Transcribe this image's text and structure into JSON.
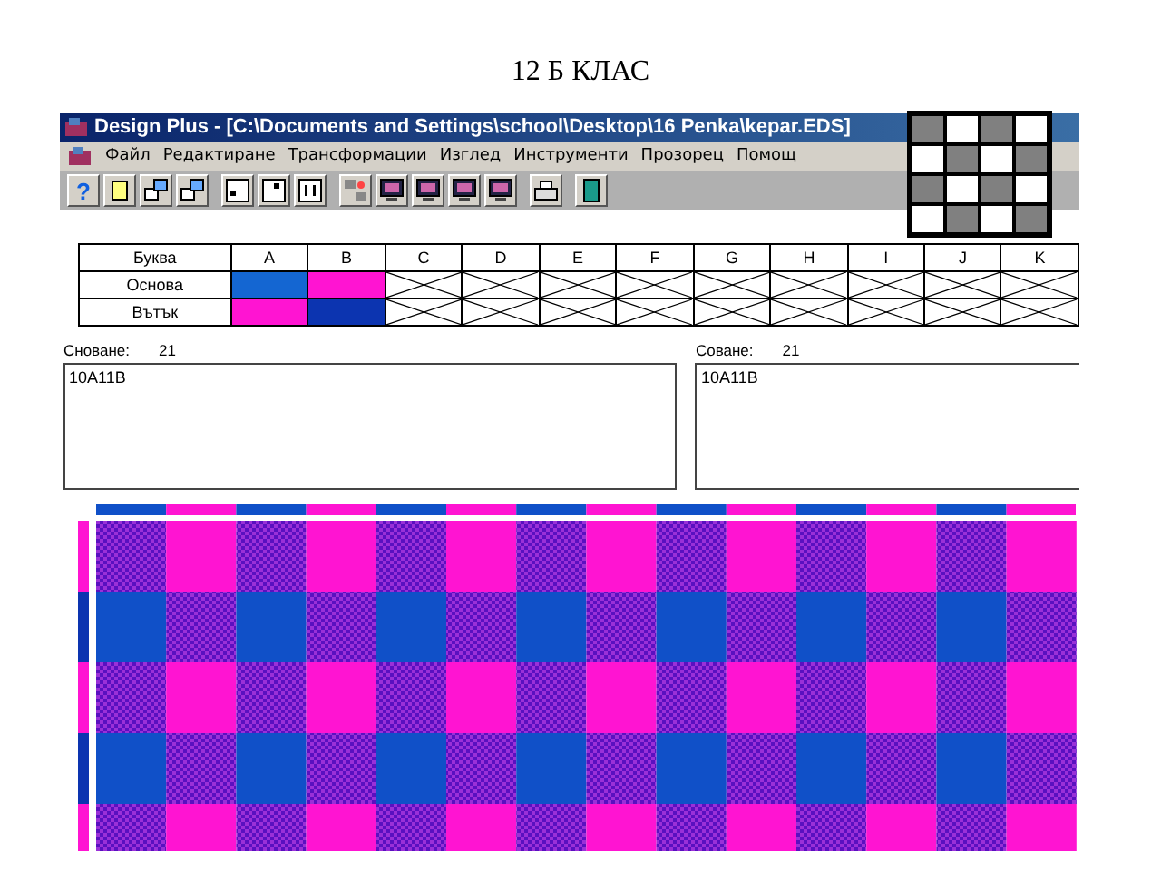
{
  "page_title": "12 Б КЛАС",
  "window": {
    "title": "Design Plus - [C:\\Documents and Settings\\school\\Desktop\\16 Penka\\kepar.EDS]"
  },
  "menu": [
    "Файл",
    "Редактиране",
    "Трансформации",
    "Изглед",
    "Инструменти",
    "Прозорец",
    "Помощ"
  ],
  "toolbar": [
    {
      "kind": "help",
      "label": "?"
    },
    {
      "kind": "new"
    },
    {
      "kind": "open"
    },
    {
      "kind": "save"
    },
    {
      "kind": "zoom-out"
    },
    {
      "kind": "zoom-in"
    },
    {
      "kind": "actual-size"
    },
    {
      "kind": "colors"
    },
    {
      "kind": "monitor"
    },
    {
      "kind": "monitor"
    },
    {
      "kind": "monitor"
    },
    {
      "kind": "monitor"
    },
    {
      "kind": "print"
    },
    {
      "kind": "exit"
    }
  ],
  "table": {
    "columns": [
      "Буква",
      "A",
      "B",
      "C",
      "D",
      "E",
      "F",
      "G",
      "H",
      "I",
      "J",
      "K"
    ],
    "rows": [
      {
        "label": "Основа",
        "cells": [
          {
            "kind": "color",
            "color": "#1466d2"
          },
          {
            "kind": "color",
            "color": "#ff14d2"
          },
          {
            "kind": "empty"
          },
          {
            "kind": "empty"
          },
          {
            "kind": "empty"
          },
          {
            "kind": "empty"
          },
          {
            "kind": "empty"
          },
          {
            "kind": "empty"
          },
          {
            "kind": "empty"
          },
          {
            "kind": "empty"
          },
          {
            "kind": "empty"
          }
        ]
      },
      {
        "label": "Вътък",
        "cells": [
          {
            "kind": "color",
            "color": "#ff14d2"
          },
          {
            "kind": "color",
            "color": "#0c34b0"
          },
          {
            "kind": "empty"
          },
          {
            "kind": "empty"
          },
          {
            "kind": "empty"
          },
          {
            "kind": "empty"
          },
          {
            "kind": "empty"
          },
          {
            "kind": "empty"
          },
          {
            "kind": "empty"
          },
          {
            "kind": "empty"
          },
          {
            "kind": "empty"
          }
        ]
      }
    ]
  },
  "warp": {
    "label": "Сноване:",
    "count": "21",
    "value": "10A11B"
  },
  "weft": {
    "label": "Соване:",
    "count": "21",
    "value": "10A11B"
  }
}
